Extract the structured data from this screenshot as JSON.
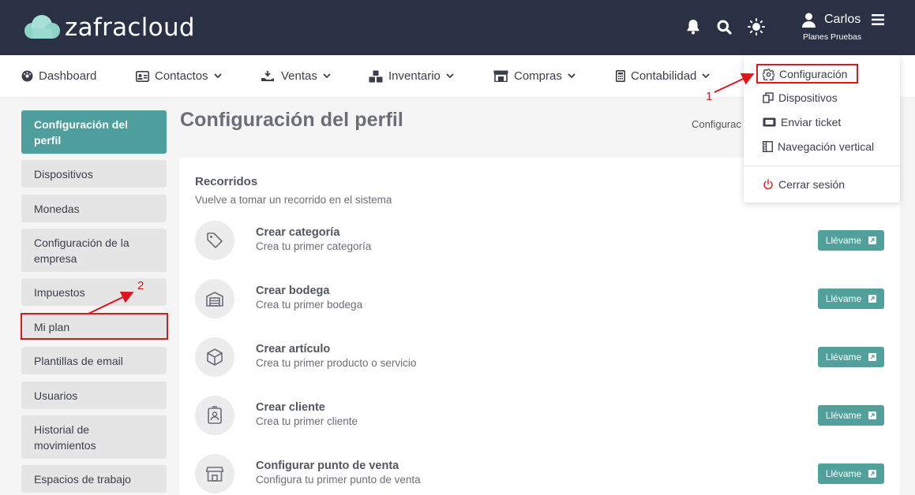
{
  "app": {
    "logo_text": "zafracloud",
    "brand_color": "#2b3144",
    "accent_color": "#52a09c"
  },
  "header": {
    "icons": [
      "bell-icon",
      "search-icon",
      "sun-icon",
      "user-icon",
      "menu-icon"
    ],
    "user_name": "Carlos",
    "user_plan": "Planes Pruebas"
  },
  "nav": {
    "items": [
      {
        "label": "Dashboard",
        "icon": "dashboard-icon"
      },
      {
        "label": "Contactos",
        "icon": "contacts-icon"
      },
      {
        "label": "Ventas",
        "icon": "sales-icon"
      },
      {
        "label": "Inventario",
        "icon": "inventory-icon"
      },
      {
        "label": "Compras",
        "icon": "store-icon"
      },
      {
        "label": "Contabilidad",
        "icon": "calculator-icon"
      }
    ]
  },
  "sidebar": {
    "items": [
      {
        "label": "Configuración del perfil"
      },
      {
        "label": "Dispositivos"
      },
      {
        "label": "Monedas"
      },
      {
        "label": "Configuración de la empresa"
      },
      {
        "label": "Impuestos"
      },
      {
        "label": "Mi plan"
      },
      {
        "label": "Plantillas de email"
      },
      {
        "label": "Usuarios"
      },
      {
        "label": "Historial de movimientos"
      },
      {
        "label": "Espacios de trabajo"
      }
    ]
  },
  "page": {
    "title": "Configuración del perfil",
    "breadcrumb": "Configurac"
  },
  "tours": {
    "title": "Recorridos",
    "subtitle": "Vuelve a tomar un recorrido en el sistema",
    "button_label": "Llévame",
    "items": [
      {
        "title": "Crear categoría",
        "desc": "Crea tu primer categoría",
        "icon": "tag-icon"
      },
      {
        "title": "Crear bodega",
        "desc": "Crea tu primer bodega",
        "icon": "warehouse-icon"
      },
      {
        "title": "Crear artículo",
        "desc": "Crea tu primer producto o servicio",
        "icon": "box-icon"
      },
      {
        "title": "Crear cliente",
        "desc": "Crea tu primer cliente",
        "icon": "contact-card-icon"
      },
      {
        "title": "Configurar punto de venta",
        "desc": "Configura tu primer punto de venta",
        "icon": "shop-icon"
      }
    ]
  },
  "dropdown": {
    "items": [
      {
        "label": "Configuración",
        "icon": "gear-icon"
      },
      {
        "label": "Dispositivos",
        "icon": "devices-icon"
      },
      {
        "label": "Enviar ticket",
        "icon": "ticket-icon"
      },
      {
        "label": "Navegación vertical",
        "icon": "sidebar-layout-icon"
      }
    ],
    "logout_label": "Cerrar sesión"
  },
  "annotations": {
    "step1": "1",
    "step2": "2",
    "color": "#e0151c"
  }
}
